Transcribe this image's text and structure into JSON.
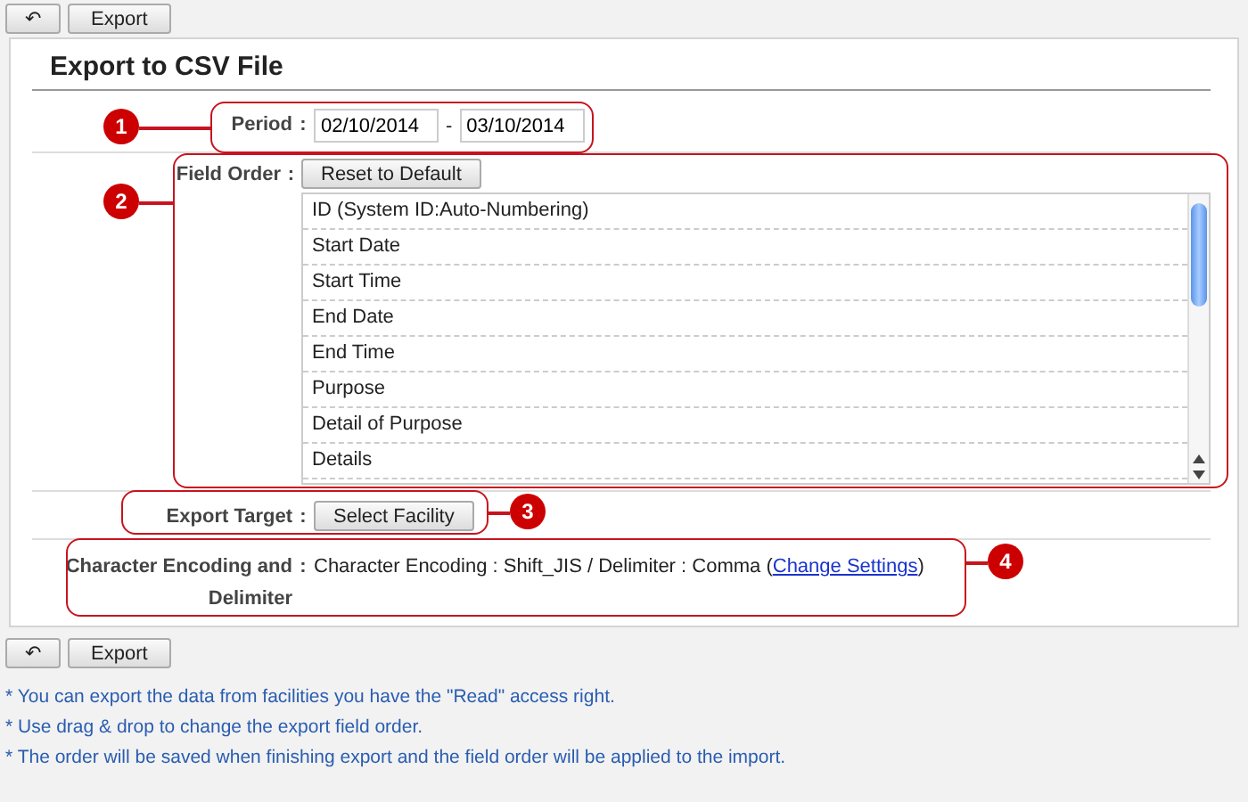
{
  "toolbar_top": {
    "back": "↶",
    "export": "Export"
  },
  "title": "Export to CSV File",
  "period": {
    "label": "Period",
    "colon": ":",
    "from": "02/10/2014",
    "sep": "-",
    "to": "03/10/2014"
  },
  "field_order": {
    "label": "Field Order",
    "colon": ":",
    "reset": "Reset to Default",
    "items": [
      "ID (System ID:Auto-Numbering)",
      "Start Date",
      "Start Time",
      "End Date",
      "End Time",
      "Purpose",
      "Detail of Purpose",
      "Details"
    ]
  },
  "export_target": {
    "label": "Export Target",
    "colon": ":",
    "button": "Select Facility"
  },
  "encoding": {
    "label": "Character Encoding and Delimiter",
    "colon": ":",
    "text": "Character Encoding : Shift_JIS / Delimiter : Comma (",
    "link": "Change Settings",
    "after": ")"
  },
  "toolbar_bottom": {
    "back": "↶",
    "export": "Export"
  },
  "notes": [
    "* You can export the data from facilities you have the \"Read\" access right.",
    "* Use drag & drop to change the export field order.",
    "* The order will be saved when finishing export and the field order will be applied to the import."
  ],
  "callouts": [
    "1",
    "2",
    "3",
    "4"
  ]
}
